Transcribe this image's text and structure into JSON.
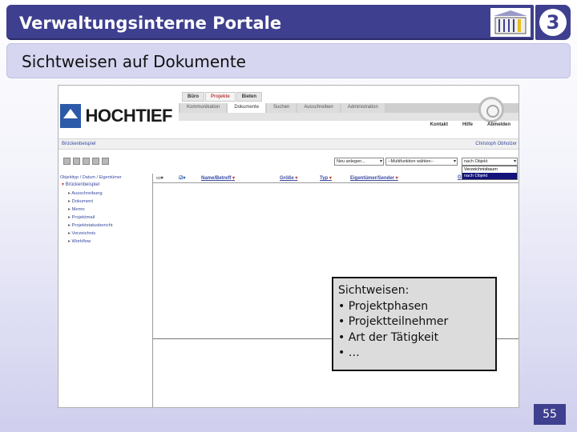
{
  "slide": {
    "title": "Verwaltungsinterne Portale",
    "subtitle": "Sichtweisen auf Dokumente",
    "logo_number": "3",
    "page_number": "55"
  },
  "colors": {
    "header_bg": "#3f3f8f",
    "subtitle_bg": "#d6d6f1",
    "link": "#3a4aa0",
    "accent_red": "#c04040"
  },
  "app": {
    "logo_text": "HOCHTIEF",
    "top_tabs": [
      "Büro",
      "Projekte",
      "Bieten"
    ],
    "sub_tabs": [
      "Kommunikation",
      "Dokumente",
      "Suchen",
      "Ausschreiben",
      "Administration"
    ],
    "top_links": [
      "Kontakt",
      "Hilfe",
      "Abmelden"
    ],
    "breadcrumb": "Brückenbeispiel",
    "user": "Christoph Obholzer",
    "select_new": "Neu anlegen...",
    "select_multi": "--Multifunktion wählen--",
    "select_view": "nach Objekt",
    "view_options": [
      "Verzeichnisbaum",
      "nach Objekt"
    ],
    "tree": {
      "header": "Objekttyp / Datum / Eigentümer",
      "root": "Brückenbeispiel",
      "items": [
        "Ausschreibung",
        "Dokument",
        "Memo",
        "Projektmail",
        "Projektstatusbericht",
        "Verzeichnis",
        "Workflow"
      ]
    },
    "columns": [
      "Name/Betreff",
      "Größe",
      "Typ",
      "Eigentümer/Sender",
      "G"
    ]
  },
  "callout": {
    "heading": "Sichtweisen:",
    "items": [
      "Projektphasen",
      "Projektteilnehmer",
      "Art der Tätigkeit",
      "…"
    ]
  }
}
